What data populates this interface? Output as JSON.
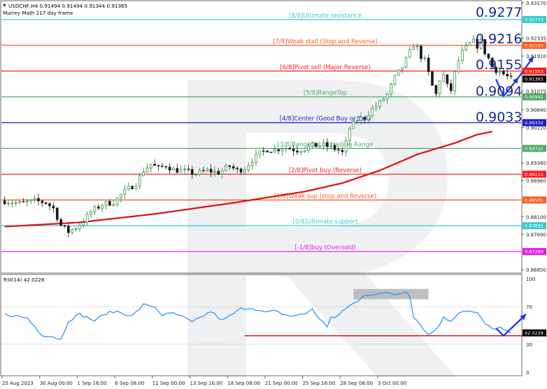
{
  "chart_data": {
    "type": "candlestick",
    "symbol_header": "USDCHF,H4  0.91494 0.91494 0.91344 0.91365",
    "subtitle": "Murrey Math 217 day frame",
    "ylim": [
      0.8682,
      0.9317
    ],
    "price_ticks": [
      "0.93170",
      "0.92335",
      "0.91910",
      "0.91075",
      "0.90640",
      "0.90220",
      "0.89380",
      "0.88960",
      "0.88100",
      "0.87690",
      "0.86850"
    ],
    "current_price": "0.91365",
    "big_levels": [
      "0.9277",
      "0.9216",
      "0.9155",
      "0.9094",
      "0.9033"
    ],
    "murrey_levels": [
      {
        "label": "[8/8]Ultimate resistance",
        "price": 0.92773,
        "badge": "0.92773",
        "color": "#33cccc"
      },
      {
        "label": "[7/8]Weak stall (Stop and Reverse)",
        "price": 0.92163,
        "badge": "0.92163",
        "color": "#ff5a1f"
      },
      {
        "label": "[6/8]Pivot sell (Major Reverse)",
        "price": 0.91553,
        "badge": "0.91553",
        "color": "#ff1a1a"
      },
      {
        "label": "[5/8]RangeTop",
        "price": 0.90942,
        "badge": "0.90942",
        "color": "#4daa62"
      },
      {
        "label": "[4/8]Center (Good Buy or Sell)",
        "price": 0.90332,
        "badge": "0.90332",
        "color": "#1a1acc"
      },
      {
        "label": "[3/8]RangeBot of trading Range",
        "price": 0.89722,
        "badge": "0.89722",
        "color": "#4daa62"
      },
      {
        "label": "[2/8]Pivot buy (Reverse)",
        "price": 0.89111,
        "badge": "0.89111",
        "color": "#ff1a1a"
      },
      {
        "label": "[1/8]Weak sup (stop and Reverse)",
        "price": 0.88501,
        "badge": "0.88501",
        "color": "#ff5a1f"
      },
      {
        "label": "[0/8]Ultimate support",
        "price": 0.87891,
        "badge": "0.87891",
        "color": "#33cccc"
      },
      {
        "label": "[-1/8]buy (Oversold)",
        "price": 0.8728,
        "badge": "0.87280",
        "color": "#e61ae6"
      }
    ],
    "x_labels": [
      "25 Aug 2023",
      "30 Aug 00:00",
      "1 Sep 16:00",
      "6 Sep 08:00",
      "11 Sep 00:00",
      "13 Sep 16:00",
      "18 Sep 08:00",
      "21 Sep 00:00",
      "25 Sep 16:00",
      "28 Sep 08:00",
      "3 Oct 00:00"
    ],
    "candle_count": 136,
    "price_path": [
      [
        0,
        0.8848
      ],
      [
        4,
        0.8842
      ],
      [
        8,
        0.8848
      ],
      [
        11,
        0.8844
      ],
      [
        13,
        0.883
      ],
      [
        15,
        0.879
      ],
      [
        17,
        0.8775
      ],
      [
        19,
        0.8785
      ],
      [
        21,
        0.88
      ],
      [
        23,
        0.8822
      ],
      [
        26,
        0.884
      ],
      [
        29,
        0.8845
      ],
      [
        32,
        0.887
      ],
      [
        35,
        0.889
      ],
      [
        37,
        0.892
      ],
      [
        39,
        0.8935
      ],
      [
        41,
        0.8925
      ],
      [
        43,
        0.8932
      ],
      [
        45,
        0.8922
      ],
      [
        48,
        0.8918
      ],
      [
        51,
        0.8912
      ],
      [
        54,
        0.892
      ],
      [
        57,
        0.8915
      ],
      [
        60,
        0.893
      ],
      [
        62,
        0.892
      ],
      [
        64,
        0.8925
      ],
      [
        66,
        0.8945
      ],
      [
        68,
        0.896
      ],
      [
        70,
        0.897
      ],
      [
        72,
        0.8968
      ],
      [
        74,
        0.8975
      ],
      [
        76,
        0.8972
      ],
      [
        78,
        0.8968
      ],
      [
        80,
        0.8972
      ],
      [
        82,
        0.8978
      ],
      [
        85,
        0.898
      ],
      [
        87,
        0.8975
      ],
      [
        89,
        0.8968
      ],
      [
        90,
        0.8962
      ],
      [
        91,
        0.8985
      ],
      [
        92,
        0.902
      ],
      [
        94,
        0.904
      ],
      [
        96,
        0.9045
      ],
      [
        98,
        0.9065
      ],
      [
        100,
        0.908
      ],
      [
        102,
        0.91
      ],
      [
        104,
        0.914
      ],
      [
        106,
        0.9165
      ],
      [
        108,
        0.92
      ],
      [
        109,
        0.9218
      ],
      [
        110,
        0.921
      ],
      [
        111,
        0.919
      ],
      [
        112,
        0.918
      ],
      [
        113,
        0.915
      ],
      [
        114,
        0.912
      ],
      [
        115,
        0.91
      ],
      [
        116,
        0.9135
      ],
      [
        117,
        0.9145
      ],
      [
        118,
        0.912
      ],
      [
        119,
        0.911
      ],
      [
        120,
        0.915
      ],
      [
        121,
        0.918
      ],
      [
        122,
        0.92
      ],
      [
        123,
        0.921
      ],
      [
        124,
        0.922
      ],
      [
        125,
        0.9225
      ],
      [
        126,
        0.9215
      ],
      [
        127,
        0.9225
      ],
      [
        128,
        0.92
      ],
      [
        129,
        0.9185
      ],
      [
        130,
        0.9165
      ],
      [
        131,
        0.9158
      ],
      [
        132,
        0.9155
      ],
      [
        133,
        0.9148
      ],
      [
        134,
        0.9142
      ],
      [
        135,
        0.9137
      ]
    ],
    "ma_path": [
      [
        0,
        0.8787
      ],
      [
        20,
        0.8797
      ],
      [
        40,
        0.8817
      ],
      [
        60,
        0.8842
      ],
      [
        80,
        0.887
      ],
      [
        90,
        0.889
      ],
      [
        100,
        0.892
      ],
      [
        110,
        0.8958
      ],
      [
        120,
        0.8985
      ],
      [
        126,
        0.9005
      ],
      [
        130,
        0.9012
      ]
    ],
    "forecast_arrows": [
      {
        "points": [
          [
            131,
            0.9136
          ],
          [
            133,
            0.9096
          ],
          [
            137,
            0.914
          ]
        ]
      },
      {
        "points": [
          [
            137,
            0.914
          ],
          [
            141,
            0.919
          ]
        ]
      }
    ],
    "rsi": {
      "label": "RSI(14) 42.0228",
      "ylim": [
        0,
        100
      ],
      "ticks": [
        "100",
        "70",
        "30",
        "0"
      ],
      "current": 42.0228,
      "support_line": {
        "from": 64,
        "to": 145,
        "value": 39
      },
      "zone": {
        "from": 93,
        "to": 113,
        "low": 78,
        "high": 89
      },
      "path": [
        [
          0,
          62
        ],
        [
          6,
          58
        ],
        [
          10,
          40
        ],
        [
          13,
          38
        ],
        [
          15,
          35
        ],
        [
          17,
          55
        ],
        [
          20,
          62
        ],
        [
          24,
          55
        ],
        [
          27,
          63
        ],
        [
          30,
          65
        ],
        [
          34,
          60
        ],
        [
          37,
          72
        ],
        [
          40,
          70
        ],
        [
          42,
          61
        ],
        [
          45,
          63
        ],
        [
          48,
          58
        ],
        [
          50,
          53
        ],
        [
          52,
          58
        ],
        [
          55,
          65
        ],
        [
          58,
          55
        ],
        [
          60,
          60
        ],
        [
          63,
          68
        ],
        [
          66,
          69
        ],
        [
          69,
          64
        ],
        [
          72,
          65
        ],
        [
          76,
          60
        ],
        [
          80,
          62
        ],
        [
          82,
          68
        ],
        [
          84,
          56
        ],
        [
          86,
          49
        ],
        [
          87,
          60
        ],
        [
          88,
          58
        ],
        [
          90,
          64
        ],
        [
          92,
          72
        ],
        [
          94,
          75
        ],
        [
          96,
          82
        ],
        [
          100,
          85
        ],
        [
          104,
          83
        ],
        [
          106,
          85
        ],
        [
          107,
          87
        ],
        [
          108,
          82
        ],
        [
          109,
          60
        ],
        [
          111,
          50
        ],
        [
          113,
          40
        ],
        [
          115,
          46
        ],
        [
          117,
          58
        ],
        [
          119,
          55
        ],
        [
          121,
          64
        ],
        [
          123,
          66
        ],
        [
          126,
          63
        ],
        [
          128,
          52
        ],
        [
          130,
          46
        ],
        [
          132,
          48
        ],
        [
          133,
          45
        ],
        [
          134,
          43
        ],
        [
          135,
          42
        ]
      ],
      "arrow": {
        "points": [
          [
            131,
            47
          ],
          [
            133,
            39
          ],
          [
            139,
            62
          ]
        ]
      }
    }
  }
}
